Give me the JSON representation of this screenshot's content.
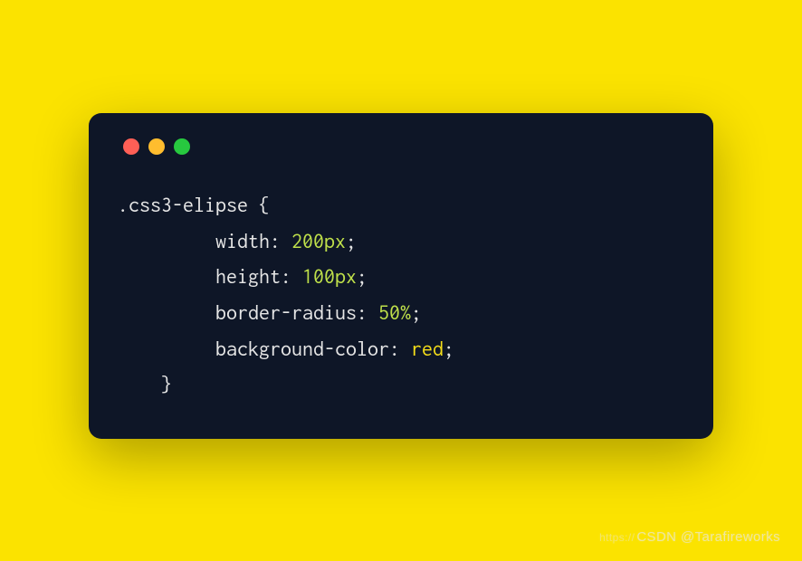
{
  "code": {
    "selector": ".css3-elipse",
    "open_brace": "{",
    "close_brace": "}",
    "lines": [
      {
        "prop": "width",
        "value": "200px",
        "value_class": "num"
      },
      {
        "prop": "height",
        "value": "100px",
        "value_class": "num"
      },
      {
        "prop": "border-radius",
        "value": "50%",
        "value_class": "num"
      },
      {
        "prop": "background-color",
        "value": "red",
        "value_class": "val"
      }
    ]
  },
  "watermark": {
    "prefix": "https://",
    "text": "CSDN @Tarafireworks"
  }
}
